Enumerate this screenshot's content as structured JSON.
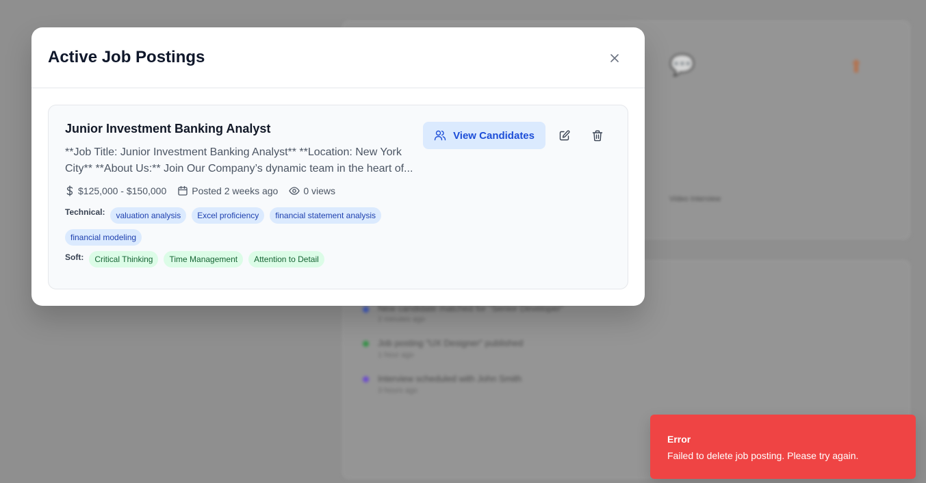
{
  "modal": {
    "title": "Active Job Postings",
    "close_icon": "close-icon"
  },
  "job": {
    "title": "Junior Investment Banking Analyst",
    "description": "**Job Title: Junior Investment Banking Analyst** **Location: New York City** **About Us:** Join Our Company’s dynamic team in the heart of...",
    "salary": "$125,000 - $150,000",
    "posted": "Posted 2 weeks ago",
    "views": "0 views",
    "technical_label": "Technical:",
    "technical_skills": [
      "valuation analysis",
      "Excel proficiency",
      "financial statement analysis",
      "financial modeling"
    ],
    "soft_label": "Soft:",
    "soft_skills": [
      "Critical Thinking",
      "Time Management",
      "Attention to Detail"
    ],
    "view_candidates_label": "View Candidates"
  },
  "toast": {
    "title": "Error",
    "message": "Failed to delete job posting. Please try again.",
    "color": "#ef4444"
  },
  "background": {
    "video_interview_label": "Video Interview",
    "activity": [
      {
        "text": "New candidate matched for \"Senior Developer\"",
        "time": "2 minutes ago",
        "color": "#3b5bdb"
      },
      {
        "text": "Job posting \"UX Designer\" published",
        "time": "1 hour ago",
        "color": "#2f9e44"
      },
      {
        "text": "Interview scheduled with John Smith",
        "time": "3 hours ago",
        "color": "#7048e8"
      }
    ]
  }
}
